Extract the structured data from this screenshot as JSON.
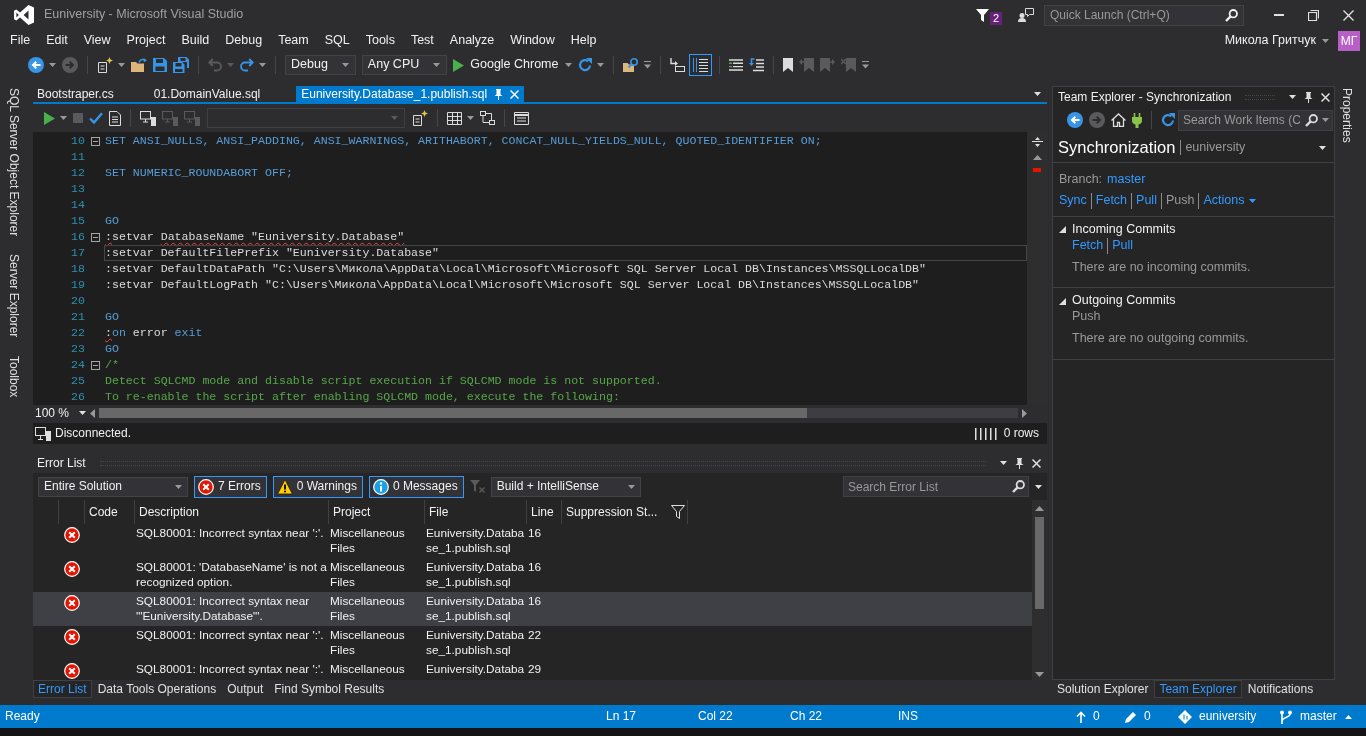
{
  "window": {
    "title": "Euniversity - Microsoft Visual Studio",
    "notifications": "2",
    "quick_launch": {
      "placeholder": "Quick Launch (Ctrl+Q)"
    }
  },
  "menu": [
    "File",
    "Edit",
    "View",
    "Project",
    "Build",
    "Debug",
    "Team",
    "SQL",
    "Tools",
    "Test",
    "Analyze",
    "Window",
    "Help"
  ],
  "account": {
    "name": "Микола Гритчук",
    "initials": "МГ"
  },
  "toolbar": {
    "groups": [
      [
        {
          "kind": "back",
          "disabled": false,
          "on": false
        },
        {
          "kind": "caret",
          "disabled": false,
          "on": false
        },
        {
          "kind": "forward",
          "disabled": true,
          "on": false
        }
      ],
      [
        {
          "kind": "newproject",
          "disabled": false,
          "on": false
        },
        {
          "kind": "caret",
          "disabled": false,
          "on": false
        },
        {
          "kind": "open",
          "disabled": false,
          "on": false
        },
        {
          "kind": "save",
          "disabled": false,
          "on": false
        },
        {
          "kind": "saveall",
          "disabled": false,
          "on": false
        }
      ],
      [
        {
          "kind": "undo",
          "disabled": true,
          "on": false
        },
        {
          "kind": "caret",
          "disabled": true,
          "on": false
        },
        {
          "kind": "redo",
          "disabled": false,
          "on": false
        },
        {
          "kind": "caret",
          "disabled": false,
          "on": false
        }
      ],
      [
        {
          "kind": "dropdown",
          "value": "Debug",
          "disabled": false,
          "on": false
        },
        {
          "kind": "dropdown",
          "value": "Any CPU",
          "disabled": false,
          "on": false
        },
        {
          "kind": "start",
          "value": "Google Chrome",
          "disabled": false,
          "on": false
        },
        {
          "kind": "refresh",
          "disabled": false,
          "on": false
        },
        {
          "kind": "caret",
          "disabled": false,
          "on": false
        }
      ],
      [
        {
          "kind": "findfiles",
          "disabled": false,
          "on": false
        },
        {
          "kind": "overflow",
          "disabled": false,
          "on": false
        }
      ],
      [
        {
          "kind": "arrowbox",
          "disabled": false,
          "on": false
        },
        {
          "kind": "linespanel",
          "disabled": false,
          "on": true
        }
      ],
      [
        {
          "kind": "comment",
          "disabled": false,
          "on": false
        },
        {
          "kind": "uncomment",
          "disabled": false,
          "on": false
        }
      ],
      [
        {
          "kind": "bookmark",
          "disabled": false,
          "on": false
        },
        {
          "kind": "bookprev",
          "disabled": true,
          "on": false
        },
        {
          "kind": "booknext",
          "disabled": true,
          "on": false
        },
        {
          "kind": "bookclear",
          "disabled": true,
          "on": false
        },
        {
          "kind": "overflow",
          "disabled": false,
          "on": false
        }
      ]
    ]
  },
  "left_tool_tabs": [
    "SQL Server Object Explorer",
    "Server Explorer",
    "Toolbox"
  ],
  "document_tabs": [
    {
      "label": "Bootstraper.cs",
      "selected": false
    },
    {
      "label": "01.DomainValue.sql",
      "selected": false
    },
    {
      "label": "Euniversity.Database_1.publish.sql",
      "selected": true
    }
  ],
  "editor": {
    "toolbar": {
      "groups": [
        [
          {
            "kind": "execute",
            "disabled": false,
            "on": false
          },
          {
            "kind": "caret",
            "disabled": false,
            "on": false
          },
          {
            "kind": "stop",
            "disabled": true,
            "on": false
          },
          {
            "kind": "parse",
            "disabled": false,
            "on": false
          },
          {
            "kind": "plan",
            "disabled": false,
            "on": false
          }
        ],
        [
          {
            "kind": "connect",
            "disabled": false,
            "on": false
          },
          {
            "kind": "disconnect",
            "disabled": true,
            "on": false
          },
          {
            "kind": "changeconn",
            "disabled": true,
            "on": false
          },
          {
            "kind": "database",
            "disabled": true,
            "on": false
          },
          {
            "kind": "newquery",
            "disabled": false,
            "on": false
          }
        ],
        [
          {
            "kind": "grid",
            "disabled": false,
            "on": false
          },
          {
            "kind": "caret",
            "disabled": false,
            "on": false
          },
          {
            "kind": "diagram",
            "disabled": false,
            "on": false
          }
        ],
        [
          {
            "kind": "results",
            "disabled": false,
            "on": false
          }
        ]
      ]
    },
    "lines": [
      {
        "number": "10",
        "fold": true,
        "current": false,
        "segments": [
          {
            "text": "SET ANSI_NULLS, ANSI_PADDING, ANSI_WARNINGS, ARITHABORT, CONCAT_NULL_YIELDS_NULL, QUOTED_IDENTIFIER ON;",
            "kind": "keyword"
          }
        ]
      },
      {
        "number": "11",
        "fold": false,
        "current": false
      },
      {
        "number": "12",
        "fold": false,
        "current": false,
        "segments": [
          {
            "text": "SET NUMERIC_ROUNDABORT OFF;",
            "kind": "keyword"
          }
        ]
      },
      {
        "number": "13",
        "fold": false,
        "current": false
      },
      {
        "number": "14",
        "fold": false,
        "current": false
      },
      {
        "number": "15",
        "fold": false,
        "current": false,
        "segments": [
          {
            "text": "GO",
            "kind": "keyword"
          }
        ]
      },
      {
        "number": "16",
        "fold": true,
        "current": false,
        "segments": [
          {
            "text": ":",
            "kind": "error"
          },
          {
            "text": "setvar ",
            "kind": "plain"
          },
          {
            "text": "DatabaseName \"Euniversity.Database\"",
            "kind": "error"
          }
        ]
      },
      {
        "number": "17",
        "fold": false,
        "current": true,
        "segments": [
          {
            "text": ":setvar DefaultFilePrefix \"Euniversity.Database\"",
            "kind": "plain"
          }
        ]
      },
      {
        "number": "18",
        "fold": false,
        "current": false,
        "segments": [
          {
            "text": ":setvar DefaultDataPath \"C:\\Users\\Микола\\AppData\\Local\\Microsoft\\Microsoft SQL Server Local DB\\Instances\\MSSQLLocalDB\"",
            "kind": "plain"
          }
        ]
      },
      {
        "number": "19",
        "fold": false,
        "current": false,
        "segments": [
          {
            "text": ":setvar DefaultLogPath \"C:\\Users\\Микола\\AppData\\Local\\Microsoft\\Microsoft SQL Server Local DB\\Instances\\MSSQLLocalDB\"",
            "kind": "plain"
          }
        ]
      },
      {
        "number": "20",
        "fold": false,
        "current": false
      },
      {
        "number": "21",
        "fold": false,
        "current": false,
        "segments": [
          {
            "text": "GO",
            "kind": "keyword"
          }
        ]
      },
      {
        "number": "22",
        "fold": false,
        "current": false,
        "segments": [
          {
            "text": ":",
            "kind": "error"
          },
          {
            "text": "on",
            "kind": "keyword"
          },
          {
            "text": " error ",
            "kind": "plain"
          },
          {
            "text": "exit",
            "kind": "keyword"
          }
        ]
      },
      {
        "number": "23",
        "fold": false,
        "current": false,
        "segments": [
          {
            "text": "GO",
            "kind": "keyword"
          }
        ]
      },
      {
        "number": "24",
        "fold": true,
        "current": false,
        "segments": [
          {
            "text": "/*",
            "kind": "comment"
          }
        ]
      },
      {
        "number": "25",
        "fold": false,
        "current": false,
        "segments": [
          {
            "text": "Detect SQLCMD mode and disable script execution if SQLCMD mode is not supported.",
            "kind": "comment"
          }
        ]
      },
      {
        "number": "26",
        "fold": false,
        "current": false,
        "segments": [
          {
            "text": "To re-enable the script after enabling SQLCMD mode, execute the following:",
            "kind": "comment"
          }
        ]
      }
    ],
    "zoom": "100 %",
    "connection": "Disconnected.",
    "rows": "0 rows"
  },
  "error_list": {
    "title": "Error List",
    "scope": "Entire Solution",
    "filters": [
      {
        "kind": "error",
        "label": "7 Errors",
        "on": true
      },
      {
        "kind": "warning",
        "label": "0 Warnings",
        "on": true
      },
      {
        "kind": "message",
        "label": "0 Messages",
        "on": true
      }
    ],
    "source": "Build + IntelliSense",
    "search": {
      "placeholder": "Search Error List"
    },
    "columns": [
      "Code",
      "Description",
      "Project",
      "File",
      "Line",
      "Suppression St..."
    ],
    "rows": [
      {
        "kind": "error",
        "description": "SQL80001: Incorrect syntax near ':'.",
        "project": "Miscellaneous Files",
        "file": "Euniversity.Database_1.publish.sql",
        "line": "16",
        "selected": false
      },
      {
        "kind": "error",
        "description": "SQL80001: 'DatabaseName' is not a recognized option.",
        "project": "Miscellaneous Files",
        "file": "Euniversity.Database_1.publish.sql",
        "line": "16",
        "selected": false
      },
      {
        "kind": "error",
        "description": "SQL80001: Incorrect syntax near '\"Euniversity.Database\"'.",
        "project": "Miscellaneous Files",
        "file": "Euniversity.Database_1.publish.sql",
        "line": "16",
        "selected": true
      },
      {
        "kind": "error",
        "description": "SQL80001: Incorrect syntax near ':'.",
        "project": "Miscellaneous Files",
        "file": "Euniversity.Database_1.publish.sql",
        "line": "22",
        "selected": false
      },
      {
        "kind": "error",
        "description": "SQL80001: Incorrect syntax near ':'.",
        "project": "Miscellaneous",
        "file": "Euniversity.Databa",
        "line": "29",
        "selected": false
      }
    ]
  },
  "bottom_tabs": [
    {
      "label": "Error List",
      "selected": true
    },
    {
      "label": "Data Tools Operations",
      "selected": false
    },
    {
      "label": "Output",
      "selected": false
    },
    {
      "label": "Find Symbol Results",
      "selected": false
    }
  ],
  "team_explorer": {
    "title": "Team Explorer - Synchronization",
    "toolbar": {
      "groups": [
        [
          {
            "kind": "back",
            "disabled": false,
            "on": false
          },
          {
            "kind": "forward",
            "disabled": true,
            "on": false
          },
          {
            "kind": "home",
            "disabled": false,
            "on": false
          },
          {
            "kind": "plug",
            "disabled": false,
            "on": false
          }
        ],
        [
          {
            "kind": "refresh",
            "disabled": false,
            "on": false
          }
        ]
      ]
    },
    "search": {
      "placeholder": "Search Work Items (C"
    },
    "page": "Synchronization",
    "context": "euniversity",
    "branch_label": "Branch:",
    "branch": "master",
    "actions": [
      {
        "label": "Sync",
        "kind": "link",
        "disabled": false
      },
      {
        "label": "Fetch",
        "kind": "link",
        "disabled": false
      },
      {
        "label": "Pull",
        "kind": "link",
        "disabled": false
      },
      {
        "label": "Push",
        "kind": "link",
        "disabled": true
      },
      {
        "label": "Actions",
        "kind": "menu",
        "disabled": false
      }
    ],
    "sections": [
      {
        "title": "Incoming Commits",
        "expanded": true,
        "links": [
          {
            "label": "Fetch",
            "disabled": false
          },
          {
            "label": "Pull",
            "disabled": false
          }
        ],
        "message": "There are no incoming commits."
      },
      {
        "title": "Outgoing Commits",
        "expanded": true,
        "links": [
          {
            "label": "Push",
            "disabled": true
          }
        ],
        "message": "There are no outgoing commits."
      }
    ]
  },
  "side_tabs": [
    {
      "label": "Solution Explorer",
      "selected": false
    },
    {
      "label": "Team Explorer",
      "selected": true
    },
    {
      "label": "Notifications",
      "selected": false
    }
  ],
  "right_tool_tabs": [
    "Properties"
  ],
  "status_bar": {
    "message": "Ready",
    "line": "Ln 17",
    "column": "Col 22",
    "char": "Ch 22",
    "mode": "INS",
    "pushes": "0",
    "changes": "0",
    "repository": "euniversity",
    "branch": "master"
  }
}
